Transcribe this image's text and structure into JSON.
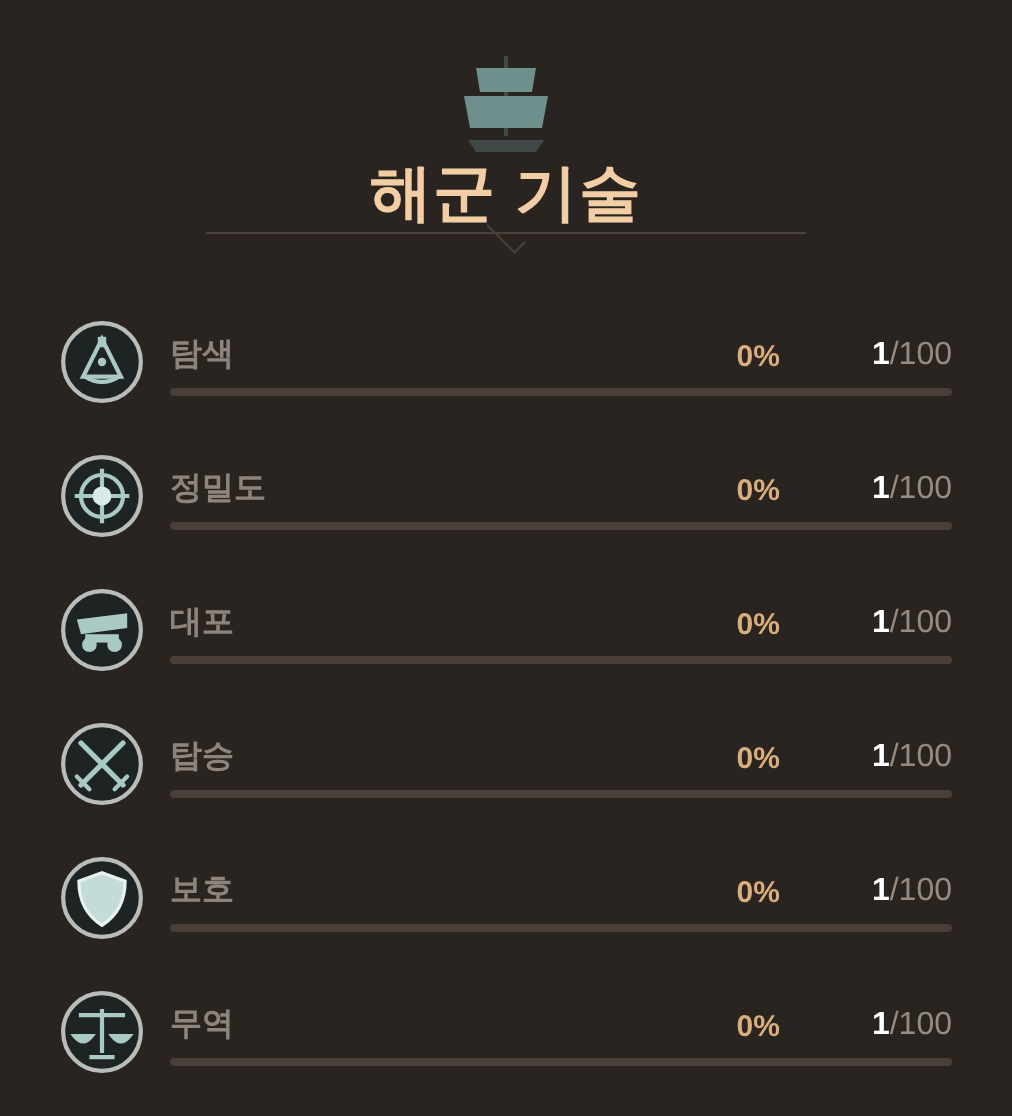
{
  "title": "해군 기술",
  "skills": [
    {
      "kind": "sextant",
      "name": "탐색",
      "percent": "0%",
      "rank": "1",
      "max": "/100",
      "level": 0
    },
    {
      "kind": "target",
      "name": "정밀도",
      "percent": "0%",
      "rank": "1",
      "max": "/100",
      "level": 0
    },
    {
      "kind": "cannon",
      "name": "대포",
      "percent": "0%",
      "rank": "1",
      "max": "/100",
      "level": 0
    },
    {
      "kind": "swords",
      "name": "탑승",
      "percent": "0%",
      "rank": "1",
      "max": "/100",
      "level": 0
    },
    {
      "kind": "shield",
      "name": "보호",
      "percent": "0%",
      "rank": "1",
      "max": "/100",
      "level": 0
    },
    {
      "kind": "scales",
      "name": "무역",
      "percent": "0%",
      "rank": "1",
      "max": "/100",
      "level": 0
    }
  ]
}
